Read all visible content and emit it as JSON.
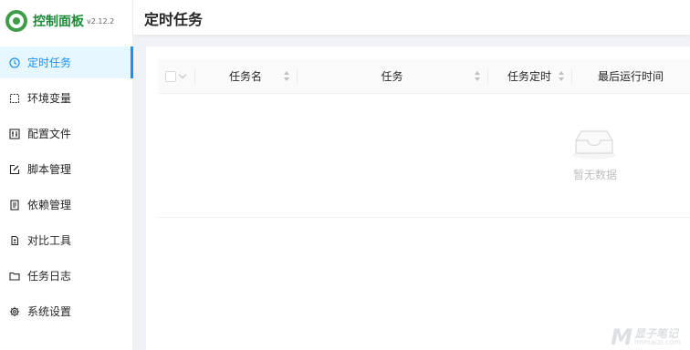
{
  "app": {
    "title": "控制面板",
    "version": "v2.12.2",
    "accent_color": "#1890ff",
    "brand_color": "#3f9d4a"
  },
  "sidebar": {
    "items": [
      {
        "label": "定时任务",
        "icon": "clock-icon",
        "active": true
      },
      {
        "label": "环境变量",
        "icon": "dashed-box-icon",
        "active": false
      },
      {
        "label": "配置文件",
        "icon": "sliders-icon",
        "active": false
      },
      {
        "label": "脚本管理",
        "icon": "edit-icon",
        "active": false
      },
      {
        "label": "依赖管理",
        "icon": "package-icon",
        "active": false
      },
      {
        "label": "对比工具",
        "icon": "compare-icon",
        "active": false
      },
      {
        "label": "任务日志",
        "icon": "folder-icon",
        "active": false
      },
      {
        "label": "系统设置",
        "icon": "gear-icon",
        "active": false
      }
    ]
  },
  "header": {
    "title": "定时任务"
  },
  "table": {
    "columns": [
      "任务名",
      "任务",
      "任务定时",
      "最后运行时间"
    ],
    "empty_text": "暂无数据"
  },
  "watermark": {
    "brand": "M",
    "cn": "显子笔记",
    "en": "lmmaizi.com"
  }
}
